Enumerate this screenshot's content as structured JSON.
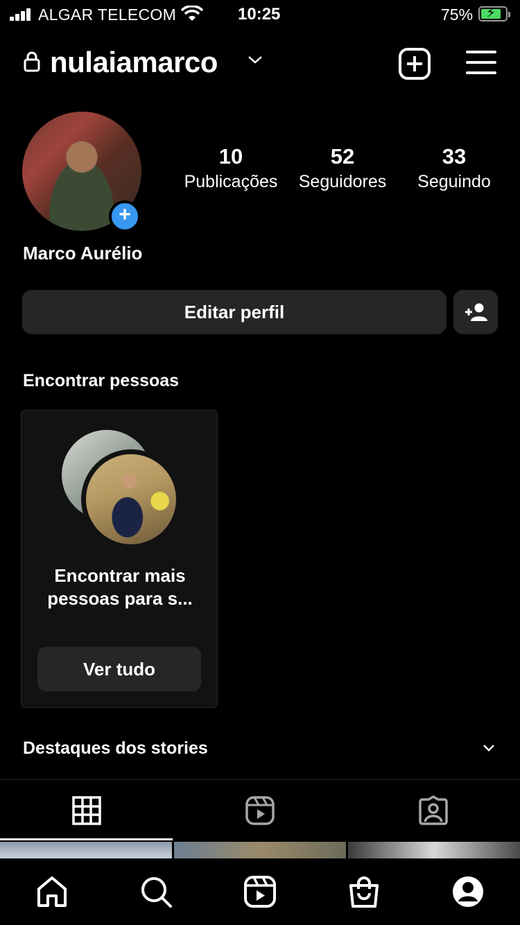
{
  "status_bar": {
    "carrier": "ALGAR TELECOM",
    "time": "10:25",
    "battery": "75%",
    "battery_level": 0.75,
    "battery_color": "#4cd964"
  },
  "header": {
    "username": "nulaiamarco",
    "icons": [
      "lock-icon",
      "chevron-down-icon",
      "new-post-icon",
      "menu-icon"
    ]
  },
  "profile": {
    "display_name": "Marco Aurélio",
    "stats": [
      {
        "value": "10",
        "label": "Publicações"
      },
      {
        "value": "52",
        "label": "Seguidores"
      },
      {
        "value": "33",
        "label": "Seguindo"
      }
    ],
    "edit_button": "Editar perfil"
  },
  "suggestions": {
    "title": "Encontrar pessoas",
    "card_text": "Encontrar mais pessoas para s...",
    "card_button": "Ver tudo"
  },
  "highlights": {
    "title": "Destaques dos stories"
  },
  "tabs": [
    "grid-icon",
    "reels-icon",
    "tagged-icon"
  ],
  "bottom_nav": [
    "home-icon",
    "search-icon",
    "reels-icon",
    "shop-icon",
    "profile-icon"
  ],
  "colors": {
    "background": "#000000",
    "button": "#262626",
    "accent": "#3897f0"
  }
}
